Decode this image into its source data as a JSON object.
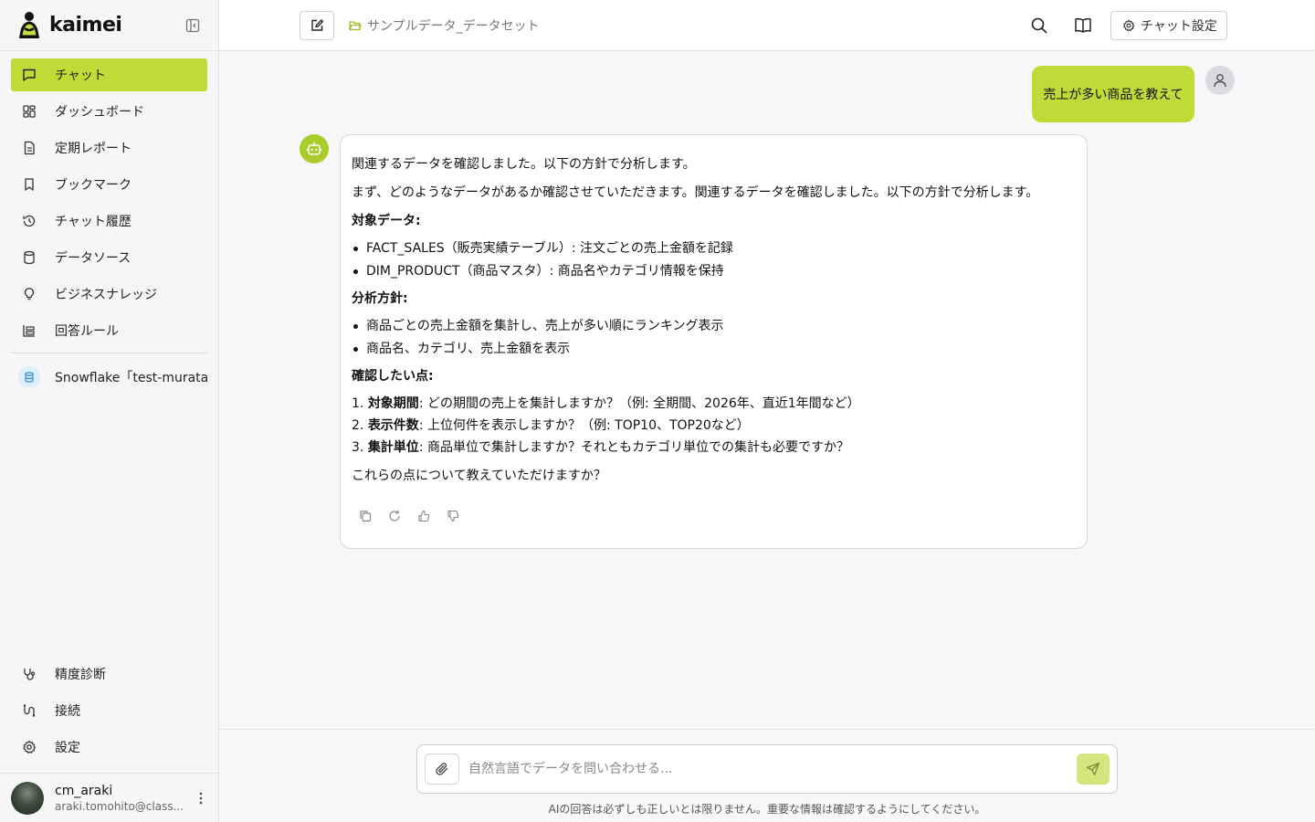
{
  "app": {
    "name": "kaimei"
  },
  "sidebar": {
    "items": [
      {
        "label": "チャット",
        "icon": "chat-icon",
        "active": true
      },
      {
        "label": "ダッシュボード",
        "icon": "dashboard-icon"
      },
      {
        "label": "定期レポート",
        "icon": "report-icon"
      },
      {
        "label": "ブックマーク",
        "icon": "bookmark-icon"
      },
      {
        "label": "チャット履歴",
        "icon": "history-icon"
      },
      {
        "label": "データソース",
        "icon": "database-icon"
      },
      {
        "label": "ビジネスナレッジ",
        "icon": "lightbulb-icon"
      },
      {
        "label": "回答ルール",
        "icon": "rules-icon"
      }
    ],
    "source": {
      "label": "Snowflake「test-murata」"
    },
    "bottom_items": [
      {
        "label": "精度診断",
        "icon": "stethoscope-icon"
      },
      {
        "label": "接続",
        "icon": "connection-icon"
      },
      {
        "label": "設定",
        "icon": "gear-icon"
      }
    ],
    "user": {
      "name": "cm_araki",
      "email": "araki.tomohito@class..."
    }
  },
  "header": {
    "breadcrumb": "サンプルデータ_データセット",
    "settings_label": "チャット設定"
  },
  "chat": {
    "user_message": "売上が多い商品を教えて",
    "bot": {
      "p1": "関連するデータを確認しました。以下の方針で分析します。",
      "p2": "まず、どのようなデータがあるか確認させていただきます。関連するデータを確認しました。以下の方針で分析します。",
      "target_heading": "対象データ:",
      "target_items": [
        "FACT_SALES（販売実績テーブル）: 注文ごとの売上金額を記録",
        "DIM_PRODUCT（商品マスタ）: 商品名やカテゴリ情報を保持"
      ],
      "policy_heading": "分析方針:",
      "policy_items": [
        "商品ごとの売上金額を集計し、売上が多い順にランキング表示",
        "商品名、カテゴリ、売上金額を表示"
      ],
      "confirm_heading": "確認したい点:",
      "confirm_items": [
        {
          "num": "1.",
          "bold": "対象期間",
          "text": ": どの期間の売上を集計しますか？（例: 全期間、2026年、直近1年間など）"
        },
        {
          "num": "2.",
          "bold": "表示件数",
          "text": ": 上位何件を表示しますか？（例: TOP10、TOP20など）"
        },
        {
          "num": "3.",
          "bold": "集計単位",
          "text": ": 商品単位で集計しますか？それともカテゴリ単位での集計も必要ですか？"
        }
      ],
      "closing": "これらの点について教えていただけますか？"
    }
  },
  "composer": {
    "placeholder": "自然言語でデータを問い合わせる...",
    "disclaimer": "AIの回答は必ずしも正しいとは限りません。重要な情報は確認するようにしてください。"
  },
  "colors": {
    "accent": "#bfdb38",
    "bot_avatar": "#aacc2c",
    "send_disabled": "#d2e67d"
  }
}
